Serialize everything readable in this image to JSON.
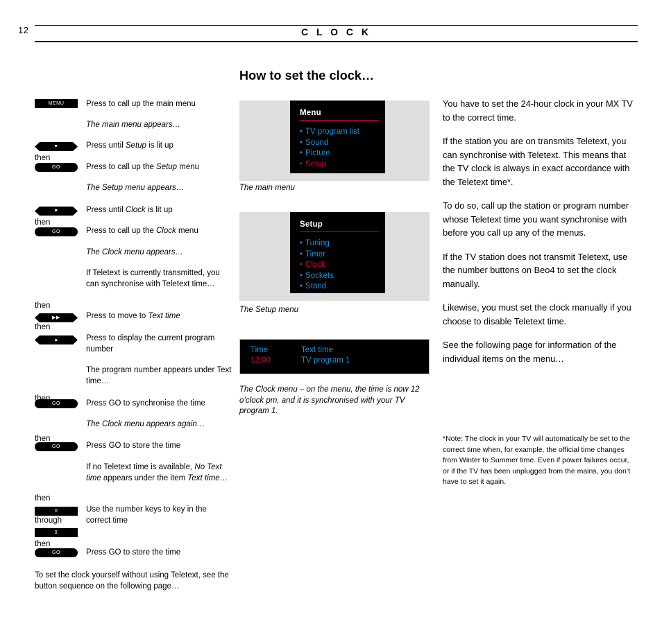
{
  "header": {
    "page_number": "12",
    "title": "C L O C K"
  },
  "section_heading": "How to set the clock…",
  "left_column": {
    "steps": [
      {
        "then": "",
        "button": "MENU",
        "button_style": "rect",
        "text": "Press to call up the main menu"
      },
      {
        "then": "",
        "button": "",
        "button_style": "none",
        "text": "The main menu appears…",
        "italic": true
      },
      {
        "then": "",
        "button": "▼",
        "button_style": "nav",
        "text_pre": "Press until ",
        "text_em": "Setup",
        "text_post": " is lit up"
      },
      {
        "then": "then",
        "button": "GO",
        "button_style": "go",
        "text_pre": "Press to call up the ",
        "text_em": "Setup",
        "text_post": " menu"
      },
      {
        "then": "",
        "button": "",
        "button_style": "none",
        "text": "The Setup menu appears…",
        "italic": true
      },
      {
        "then": "",
        "button": "▼",
        "button_style": "nav",
        "text_pre": "Press until ",
        "text_em": "Clock",
        "text_post": " is lit up"
      },
      {
        "then": "then",
        "button": "GO",
        "button_style": "go",
        "text_pre": "Press to call up the ",
        "text_em": "Clock",
        "text_post": " menu"
      },
      {
        "then": "",
        "button": "",
        "button_style": "none",
        "text": "The Clock menu appears…",
        "italic": true
      },
      {
        "then": "",
        "button": "",
        "button_style": "none",
        "text": "If Teletext is currently transmitted, you can synchronise with Teletext time…"
      },
      {
        "then": "then",
        "button": "▶▶",
        "button_style": "nav",
        "text_pre": "Press to move to ",
        "text_em": "Text time",
        "text_post": ""
      },
      {
        "then": "then",
        "button": "▲",
        "button_style": "nav",
        "text": "Press to display the current program number"
      },
      {
        "then": "",
        "button": "",
        "button_style": "none",
        "text": "The program number appears under Text time…"
      },
      {
        "then": "then",
        "button": "GO",
        "button_style": "go",
        "text": "Press GO to synchronise the time"
      },
      {
        "then": "",
        "button": "",
        "button_style": "none",
        "text": "The Clock menu appears again…",
        "italic": true
      },
      {
        "then": "then",
        "button": "GO",
        "button_style": "go",
        "text": "Press GO to store the time"
      },
      {
        "then": "",
        "button": "",
        "button_style": "none",
        "text_pre": "If no Teletext time is available, ",
        "text_em": "No Text time",
        "text_post": " appears under the item ",
        "text_em2": "Text time",
        "text_post2": "…"
      },
      {
        "then": "then",
        "button": "0",
        "button_style": "rect",
        "text": "Use the number keys to key in the correct time"
      },
      {
        "then": "through",
        "button": "9",
        "button_style": "rect",
        "text": ""
      },
      {
        "then": "then",
        "button": "GO",
        "button_style": "go",
        "text": "Press GO to store the time"
      }
    ],
    "closing_note": "To set the clock yourself without using Teletext, see the button sequence on the following  page…"
  },
  "figures": {
    "main_menu": {
      "title": "Menu",
      "items": [
        {
          "label": "TV program list",
          "state": "normal"
        },
        {
          "label": "Sound",
          "state": "normal"
        },
        {
          "label": "Picture",
          "state": "normal"
        },
        {
          "label": "Setup",
          "state": "highlighted"
        }
      ],
      "caption": "The main menu"
    },
    "setup_menu": {
      "title": "Setup",
      "items": [
        {
          "label": "Tuning",
          "state": "normal"
        },
        {
          "label": "Timer",
          "state": "normal"
        },
        {
          "label": "Clock",
          "state": "highlighted"
        },
        {
          "label": "Sockets",
          "state": "normal"
        },
        {
          "label": "Stand",
          "state": "normal"
        }
      ],
      "caption": "The Setup menu"
    },
    "clock_menu": {
      "col1_header": "Time",
      "col1_value": "12:00",
      "col2_header": "Text time",
      "col2_value": "TV program 1",
      "caption": "The Clock menu – on the menu, the time is now 12 o’clock pm, and it is synchronised with your TV program 1."
    }
  },
  "right_column": {
    "paragraphs": [
      "You have to set the 24-hour clock in your MX TV to the correct  time.",
      "If the station you are on transmits Teletext, you can synchronise with Teletext. This means that the TV clock is always in exact accordance with the Teletext time*.",
      "To do so, call up the station or program number whose Teletext time you want synchronise with before you call up any of the menus.",
      "If the TV station does not transmit Teletext, use the number buttons on Beo4 to set the clock manually.",
      "Likewise, you must set the clock manually if you choose to disable Teletext time.",
      "See the following page for information of the individual items on the menu…"
    ],
    "footnote": "*Note: The clock in your TV will automatically be set to the correct time when, for example, the official time changes from Winter to Summer time. Even if power failures occur, or if the TV has been unplugged from the mains, you don’t have to set it again."
  },
  "colors": {
    "menu_blue": "#1b8fd4",
    "menu_red": "#d4073d",
    "panel_gray": "#dedede",
    "screen_black": "#000000"
  }
}
